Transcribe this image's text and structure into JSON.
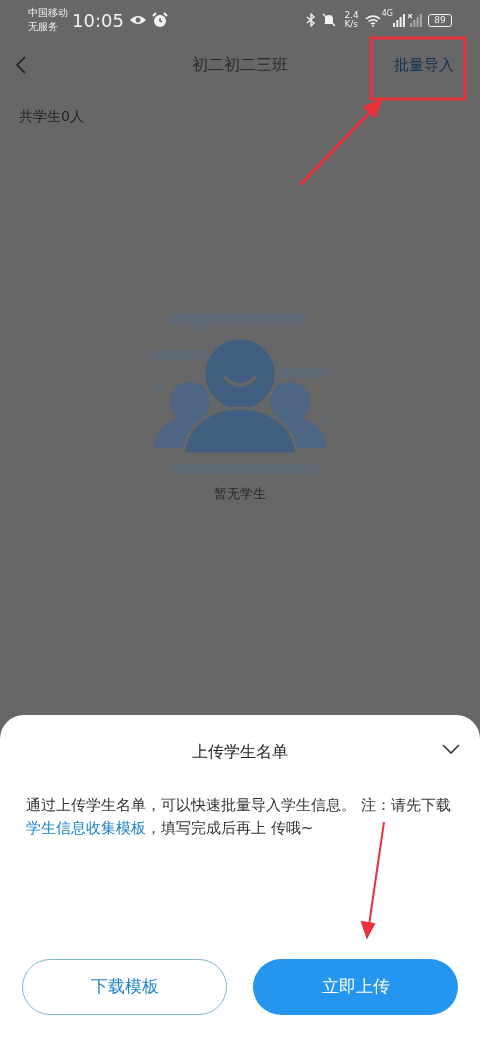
{
  "status_bar": {
    "carrier": "中国移动",
    "service": "无服务",
    "time": "10:05",
    "speed_value": "2.4",
    "speed_unit": "K/s",
    "network": "4G",
    "battery": "89"
  },
  "nav": {
    "title": "初二初二三班",
    "action": "批量导入"
  },
  "student_count": "共学生0人",
  "empty_state": {
    "text": "暂无学生"
  },
  "sheet": {
    "title": "上传学生名单",
    "description_before": "通过上传学生名单，可以快速批量导入学生信息。 注：请先下载",
    "template_link": "学生信息收集模板",
    "description_after": "，填写完成后再上 传哦~",
    "buttons": [
      {
        "label": "下载模板",
        "kind": "outline"
      },
      {
        "label": "立即上传",
        "kind": "primary"
      }
    ]
  }
}
